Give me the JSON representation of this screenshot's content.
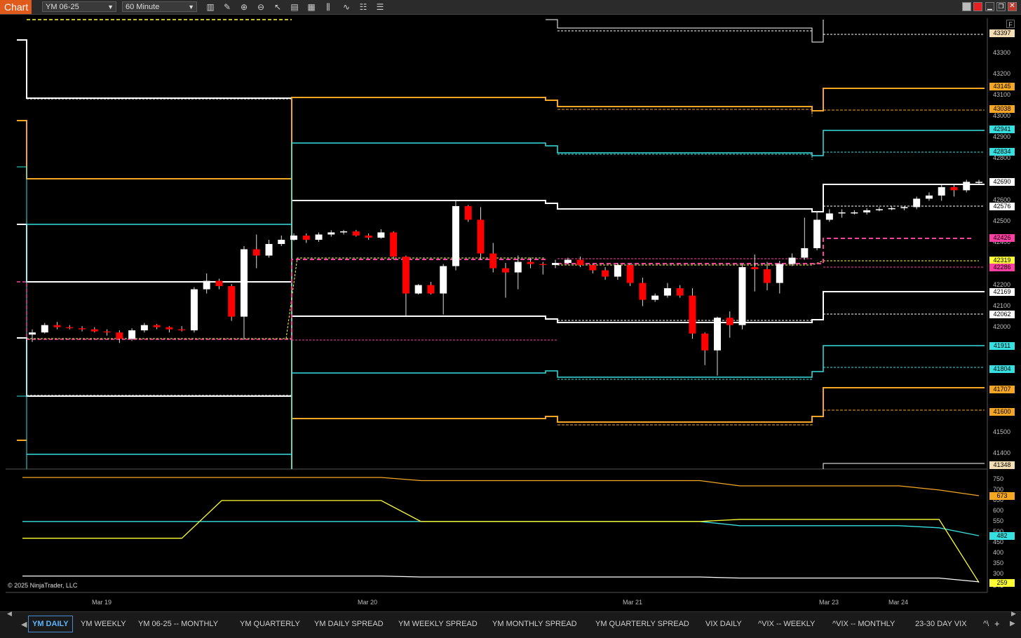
{
  "titlebar": {
    "chart_label": "Chart",
    "instrument": "YM 06-25",
    "interval": "60 Minute"
  },
  "toolbar_icons": [
    "bar-style-icon",
    "draw-pencil-icon",
    "zoom-in-icon",
    "zoom-out-icon",
    "pointer-icon",
    "data-box-icon",
    "templates-icon",
    "indicators-icon",
    "strategies-icon",
    "properties-icon",
    "drawing-list-icon"
  ],
  "price_axis": {
    "ticks": [
      "43300",
      "43200",
      "43100",
      "43000",
      "42900",
      "42800",
      "42600",
      "42500",
      "42400",
      "42200",
      "42100",
      "42000",
      "41500",
      "41400"
    ],
    "tags": [
      {
        "v": "43397",
        "color": "#f5deb3"
      },
      {
        "v": "43145",
        "color": "#f5a623"
      },
      {
        "v": "43038",
        "color": "#f5a623"
      },
      {
        "v": "42941",
        "color": "#36e0e0"
      },
      {
        "v": "42834",
        "color": "#36e0e0"
      },
      {
        "v": "42690",
        "color": "#ffffff"
      },
      {
        "v": "42576",
        "color": "#ffffff"
      },
      {
        "v": "42426",
        "color": "#ff3fa4"
      },
      {
        "v": "42319",
        "color": "#ffff33"
      },
      {
        "v": "42286",
        "color": "#ff3fa4"
      },
      {
        "v": "42169",
        "color": "#ffffff"
      },
      {
        "v": "42062",
        "color": "#ffffff"
      },
      {
        "v": "41911",
        "color": "#36e0e0"
      },
      {
        "v": "41804",
        "color": "#36e0e0"
      },
      {
        "v": "41707",
        "color": "#f5a623"
      },
      {
        "v": "41600",
        "color": "#f5a623"
      },
      {
        "v": "41348",
        "color": "#f5deb3"
      }
    ]
  },
  "indicator_axis": {
    "ticks": [
      "750",
      "700",
      "650",
      "600",
      "550",
      "500",
      "450",
      "400",
      "350",
      "300",
      "241"
    ],
    "tags": [
      {
        "v": "673",
        "color": "#f5a623"
      },
      {
        "v": "482",
        "color": "#36e0e0"
      },
      {
        "v": "259",
        "color": "#ffff33"
      }
    ]
  },
  "dates": [
    "Mar 19",
    "Mar 20",
    "Mar 21",
    "Mar 23",
    "Mar 24"
  ],
  "copyright": "© 2025 NinjaTrader, LLC",
  "f_button": "F",
  "tabs": [
    {
      "label": "YM DAILY",
      "active": true
    },
    {
      "label": "YM WEEKLY",
      "active": false
    },
    {
      "label": "YM 06-25 -- MONTHLY",
      "active": false
    },
    {
      "label": "YM QUARTERLY",
      "active": false
    },
    {
      "label": "YM DAILY SPREAD",
      "active": false
    },
    {
      "label": "YM WEEKLY SPREAD",
      "active": false
    },
    {
      "label": "YM MONTHLY SPREAD",
      "active": false
    },
    {
      "label": "YM QUARTERLY SPREAD",
      "active": false
    },
    {
      "label": "VIX DAILY",
      "active": false
    },
    {
      "label": "^VIX -- WEEKLY",
      "active": false
    },
    {
      "label": "^VIX -- MONTHLY",
      "active": false
    },
    {
      "label": "23-30 DAY VIX",
      "active": false
    },
    {
      "label": "^\\",
      "active": false
    }
  ],
  "colors": {
    "up_candle": "#ffffff",
    "down_candle": "#ff0000",
    "orange": "#f5a623",
    "cyan": "#36e0e0",
    "white": "#ffffff",
    "magenta": "#ff3fa4",
    "yellow": "#ffff33",
    "tan": "#f5deb3"
  },
  "chart_data": {
    "type": "candlestick",
    "instrument": "YM 06-25",
    "interval": "60 Minute",
    "candles": [
      {
        "o": 41965,
        "h": 41990,
        "l": 41930,
        "c": 41975
      },
      {
        "o": 41975,
        "h": 42020,
        "l": 41970,
        "c": 42010
      },
      {
        "o": 42010,
        "h": 42025,
        "l": 41990,
        "c": 42000
      },
      {
        "o": 42000,
        "h": 42010,
        "l": 41990,
        "c": 41995
      },
      {
        "o": 41995,
        "h": 42005,
        "l": 41980,
        "c": 41990
      },
      {
        "o": 41990,
        "h": 42000,
        "l": 41975,
        "c": 41980
      },
      {
        "o": 41980,
        "h": 41990,
        "l": 41960,
        "c": 41975
      },
      {
        "o": 41975,
        "h": 41985,
        "l": 41925,
        "c": 41945
      },
      {
        "o": 41945,
        "h": 41995,
        "l": 41935,
        "c": 41985
      },
      {
        "o": 41985,
        "h": 42020,
        "l": 41975,
        "c": 42010
      },
      {
        "o": 42010,
        "h": 42015,
        "l": 41990,
        "c": 42000
      },
      {
        "o": 42000,
        "h": 42005,
        "l": 41975,
        "c": 41990
      },
      {
        "o": 41990,
        "h": 42005,
        "l": 41980,
        "c": 41985
      },
      {
        "o": 41985,
        "h": 42190,
        "l": 41975,
        "c": 42180
      },
      {
        "o": 42180,
        "h": 42255,
        "l": 42160,
        "c": 42220
      },
      {
        "o": 42220,
        "h": 42230,
        "l": 42180,
        "c": 42195
      },
      {
        "o": 42195,
        "h": 42205,
        "l": 42030,
        "c": 42050
      },
      {
        "o": 42050,
        "h": 42385,
        "l": 41940,
        "c": 42370
      },
      {
        "o": 42370,
        "h": 42440,
        "l": 42280,
        "c": 42340
      },
      {
        "o": 42340,
        "h": 42415,
        "l": 42330,
        "c": 42395
      },
      {
        "o": 42395,
        "h": 42435,
        "l": 42385,
        "c": 42415
      },
      {
        "o": 42415,
        "h": 42445,
        "l": 42410,
        "c": 42435
      },
      {
        "o": 42435,
        "h": 42445,
        "l": 42400,
        "c": 42415
      },
      {
        "o": 42415,
        "h": 42450,
        "l": 42405,
        "c": 42440
      },
      {
        "o": 42440,
        "h": 42460,
        "l": 42430,
        "c": 42450
      },
      {
        "o": 42450,
        "h": 42462,
        "l": 42440,
        "c": 42455
      },
      {
        "o": 42455,
        "h": 42462,
        "l": 42430,
        "c": 42435
      },
      {
        "o": 42435,
        "h": 42445,
        "l": 42415,
        "c": 42425
      },
      {
        "o": 42425,
        "h": 42465,
        "l": 42420,
        "c": 42450
      },
      {
        "o": 42450,
        "h": 42455,
        "l": 42320,
        "c": 42335
      },
      {
        "o": 42335,
        "h": 42340,
        "l": 42055,
        "c": 42160
      },
      {
        "o": 42160,
        "h": 42205,
        "l": 42155,
        "c": 42200
      },
      {
        "o": 42200,
        "h": 42215,
        "l": 42155,
        "c": 42160
      },
      {
        "o": 42160,
        "h": 42300,
        "l": 42060,
        "c": 42290
      },
      {
        "o": 42290,
        "h": 42605,
        "l": 42270,
        "c": 42575
      },
      {
        "o": 42575,
        "h": 42580,
        "l": 42500,
        "c": 42510
      },
      {
        "o": 42510,
        "h": 42570,
        "l": 42320,
        "c": 42350
      },
      {
        "o": 42350,
        "h": 42400,
        "l": 42260,
        "c": 42280
      },
      {
        "o": 42280,
        "h": 42305,
        "l": 42140,
        "c": 42260
      },
      {
        "o": 42260,
        "h": 42340,
        "l": 42180,
        "c": 42310
      },
      {
        "o": 42310,
        "h": 42330,
        "l": 42280,
        "c": 42300
      },
      {
        "o": 42300,
        "h": 42310,
        "l": 42250,
        "c": 42295
      },
      {
        "o": 42295,
        "h": 42320,
        "l": 42280,
        "c": 42305
      },
      {
        "o": 42305,
        "h": 42330,
        "l": 42300,
        "c": 42320
      },
      {
        "o": 42320,
        "h": 42335,
        "l": 42285,
        "c": 42295
      },
      {
        "o": 42295,
        "h": 42300,
        "l": 42255,
        "c": 42270
      },
      {
        "o": 42270,
        "h": 42285,
        "l": 42225,
        "c": 42240
      },
      {
        "o": 42240,
        "h": 42305,
        "l": 42225,
        "c": 42295
      },
      {
        "o": 42295,
        "h": 42300,
        "l": 42195,
        "c": 42210
      },
      {
        "o": 42210,
        "h": 42235,
        "l": 42100,
        "c": 42130
      },
      {
        "o": 42130,
        "h": 42160,
        "l": 42120,
        "c": 42150
      },
      {
        "o": 42150,
        "h": 42210,
        "l": 42140,
        "c": 42185
      },
      {
        "o": 42185,
        "h": 42200,
        "l": 42140,
        "c": 42150
      },
      {
        "o": 42150,
        "h": 42185,
        "l": 41945,
        "c": 41970
      },
      {
        "o": 41970,
        "h": 41975,
        "l": 41820,
        "c": 41890
      },
      {
        "o": 41890,
        "h": 42050,
        "l": 41770,
        "c": 42045
      },
      {
        "o": 42045,
        "h": 42075,
        "l": 41950,
        "c": 42010
      },
      {
        "o": 42010,
        "h": 42300,
        "l": 41990,
        "c": 42285
      },
      {
        "o": 42285,
        "h": 42345,
        "l": 42170,
        "c": 42275
      },
      {
        "o": 42275,
        "h": 42310,
        "l": 42175,
        "c": 42210
      },
      {
        "o": 42210,
        "h": 42315,
        "l": 42160,
        "c": 42300
      },
      {
        "o": 42300,
        "h": 42350,
        "l": 42290,
        "c": 42330
      },
      {
        "o": 42330,
        "h": 42520,
        "l": 42320,
        "c": 42375
      },
      {
        "o": 42375,
        "h": 42550,
        "l": 42365,
        "c": 42510
      },
      {
        "o": 42510,
        "h": 42560,
        "l": 42500,
        "c": 42540
      },
      {
        "o": 42540,
        "h": 42560,
        "l": 42520,
        "c": 42545
      },
      {
        "o": 42545,
        "h": 42555,
        "l": 42535,
        "c": 42545
      },
      {
        "o": 42545,
        "h": 42565,
        "l": 42535,
        "c": 42555
      },
      {
        "o": 42555,
        "h": 42570,
        "l": 42550,
        "c": 42560
      },
      {
        "o": 42560,
        "h": 42575,
        "l": 42555,
        "c": 42565
      },
      {
        "o": 42565,
        "h": 42575,
        "l": 42555,
        "c": 42570
      },
      {
        "o": 42570,
        "h": 42620,
        "l": 42560,
        "c": 42610
      },
      {
        "o": 42610,
        "h": 42640,
        "l": 42600,
        "c": 42625
      },
      {
        "o": 42625,
        "h": 42675,
        "l": 42600,
        "c": 42665
      },
      {
        "o": 42665,
        "h": 42680,
        "l": 42620,
        "c": 42650
      },
      {
        "o": 42650,
        "h": 42700,
        "l": 42640,
        "c": 42690
      },
      {
        "o": 42690,
        "h": 42700,
        "l": 42680,
        "c": 42690
      }
    ],
    "price_ylim": [
      41330,
      43460
    ],
    "indicator_ylim": [
      235,
      770
    ],
    "indicator_series": [
      {
        "color": "#f5a623",
        "values": [
          760,
          760,
          760,
          760,
          760,
          760,
          760,
          760,
          760,
          760,
          745,
          745,
          745,
          745,
          745,
          745,
          745,
          745,
          720,
          720,
          720,
          720,
          720,
          700,
          673
        ]
      },
      {
        "color": "#36e0e0",
        "values": [
          550,
          550,
          550,
          550,
          550,
          550,
          550,
          550,
          550,
          550,
          550,
          550,
          550,
          550,
          550,
          550,
          550,
          550,
          530,
          530,
          530,
          530,
          530,
          520,
          482
        ]
      },
      {
        "color": "#ffff33",
        "values": [
          470,
          470,
          470,
          470,
          470,
          650,
          650,
          650,
          650,
          650,
          550,
          550,
          550,
          550,
          550,
          550,
          550,
          550,
          560,
          560,
          560,
          560,
          560,
          560,
          259
        ]
      },
      {
        "color": "#ffffff",
        "values": [
          290,
          290,
          290,
          290,
          290,
          290,
          290,
          290,
          290,
          290,
          285,
          285,
          285,
          285,
          285,
          285,
          285,
          285,
          280,
          280,
          280,
          280,
          280,
          280,
          262
        ]
      }
    ]
  }
}
